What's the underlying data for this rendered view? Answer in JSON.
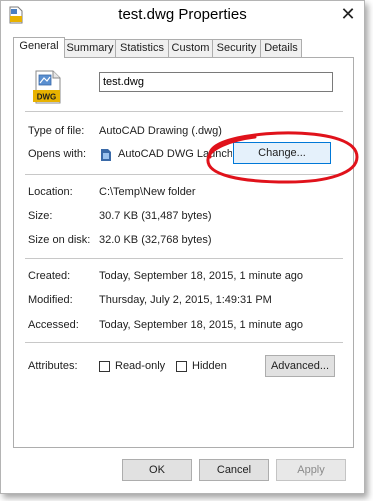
{
  "window": {
    "title": "test.dwg Properties",
    "close_glyph": "✕"
  },
  "tabs": [
    {
      "label": "General",
      "active": true
    },
    {
      "label": "Summary"
    },
    {
      "label": "Statistics"
    },
    {
      "label": "Custom"
    },
    {
      "label": "Security"
    },
    {
      "label": "Details"
    }
  ],
  "file": {
    "icon": "dwg-file-icon",
    "icon_text": "DWG",
    "name": "test.dwg"
  },
  "rows": {
    "type_label": "Type of file:",
    "type_value": "AutoCAD Drawing (.dwg)",
    "opens_label": "Opens with:",
    "opens_value": "AutoCAD DWG Launcher",
    "change_label": "Change...",
    "location_label": "Location:",
    "location_value": "C:\\Temp\\New folder",
    "size_label": "Size:",
    "size_value": "30.7 KB (31,487 bytes)",
    "size_disk_label": "Size on disk:",
    "size_disk_value": "32.0 KB (32,768 bytes)",
    "created_label": "Created:",
    "created_value": "Today, September 18, 2015, 1 minute ago",
    "modified_label": "Modified:",
    "modified_value": "Thursday, July 2, 2015, 1:49:31 PM",
    "accessed_label": "Accessed:",
    "accessed_value": "Today, September 18, 2015, 1 minute ago",
    "attributes_label": "Attributes:",
    "readonly_label": "Read-only",
    "readonly_checked": false,
    "hidden_label": "Hidden",
    "hidden_checked": false,
    "advanced_label": "Advanced..."
  },
  "footer": {
    "ok": "OK",
    "cancel": "Cancel",
    "apply": "Apply"
  },
  "colors": {
    "annotation": "#e0121b",
    "focus_border": "#0078d7"
  }
}
